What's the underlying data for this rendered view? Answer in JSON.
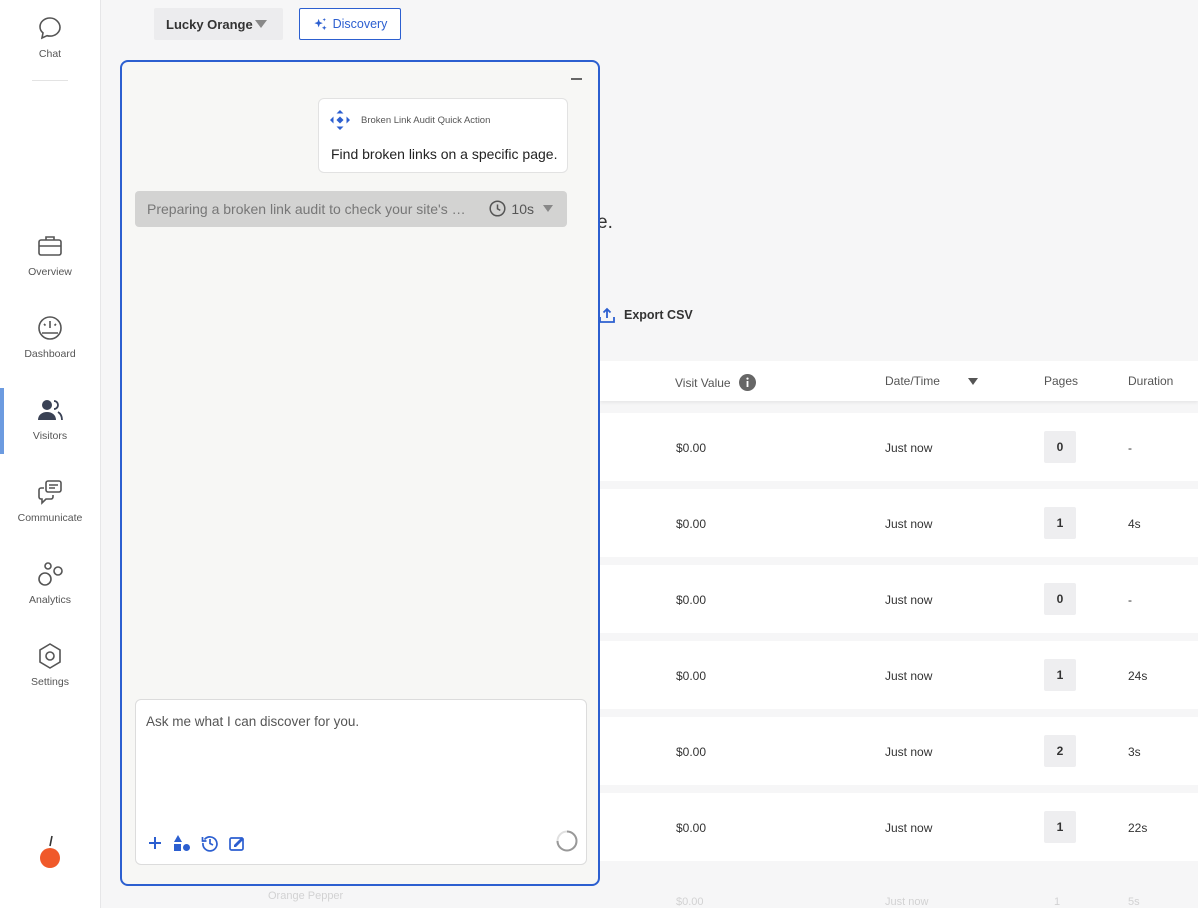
{
  "sidebar": {
    "items": [
      {
        "label": "Chat",
        "icon": "chat-bubble-icon"
      },
      {
        "label": "Overview",
        "icon": "briefcase-icon"
      },
      {
        "label": "Dashboard",
        "icon": "gauge-icon"
      },
      {
        "label": "Visitors",
        "icon": "users-icon",
        "active": true
      },
      {
        "label": "Communicate",
        "icon": "messages-icon"
      },
      {
        "label": "Analytics",
        "icon": "circles-icon"
      },
      {
        "label": "Settings",
        "icon": "hexagon-gear-icon"
      }
    ]
  },
  "topbar": {
    "site_name": "Lucky Orange",
    "discovery_label": "Discovery"
  },
  "background": {
    "partial_text": "e.",
    "export_label": "Export CSV",
    "columns": [
      "Visit Value",
      "Date/Time",
      "Pages",
      "Duration"
    ],
    "rows": [
      {
        "value": "$0.00",
        "time": "Just now",
        "pages": "0",
        "duration": "-"
      },
      {
        "value": "$0.00",
        "time": "Just now",
        "pages": "1",
        "duration": "4s"
      },
      {
        "value": "$0.00",
        "time": "Just now",
        "pages": "0",
        "duration": "-"
      },
      {
        "value": "$0.00",
        "time": "Just now",
        "pages": "1",
        "duration": "24s"
      },
      {
        "value": "$0.00",
        "time": "Just now",
        "pages": "2",
        "duration": "3s"
      },
      {
        "value": "$0.00",
        "time": "Just now",
        "pages": "1",
        "duration": "22s"
      }
    ],
    "faded_row": {
      "name": "Orange Pepper",
      "value": "$0.00",
      "time": "Just now",
      "pages": "1",
      "duration": "5s"
    }
  },
  "panel": {
    "quick_action_title": "Broken Link Audit Quick Action",
    "quick_action_body": "Find broken links on a specific page.",
    "status_text": "Preparing a broken link audit to check your site's …",
    "status_time": "10s",
    "input_placeholder": "Ask me what I can discover for you.",
    "accent_color": "#2c5fd0"
  }
}
